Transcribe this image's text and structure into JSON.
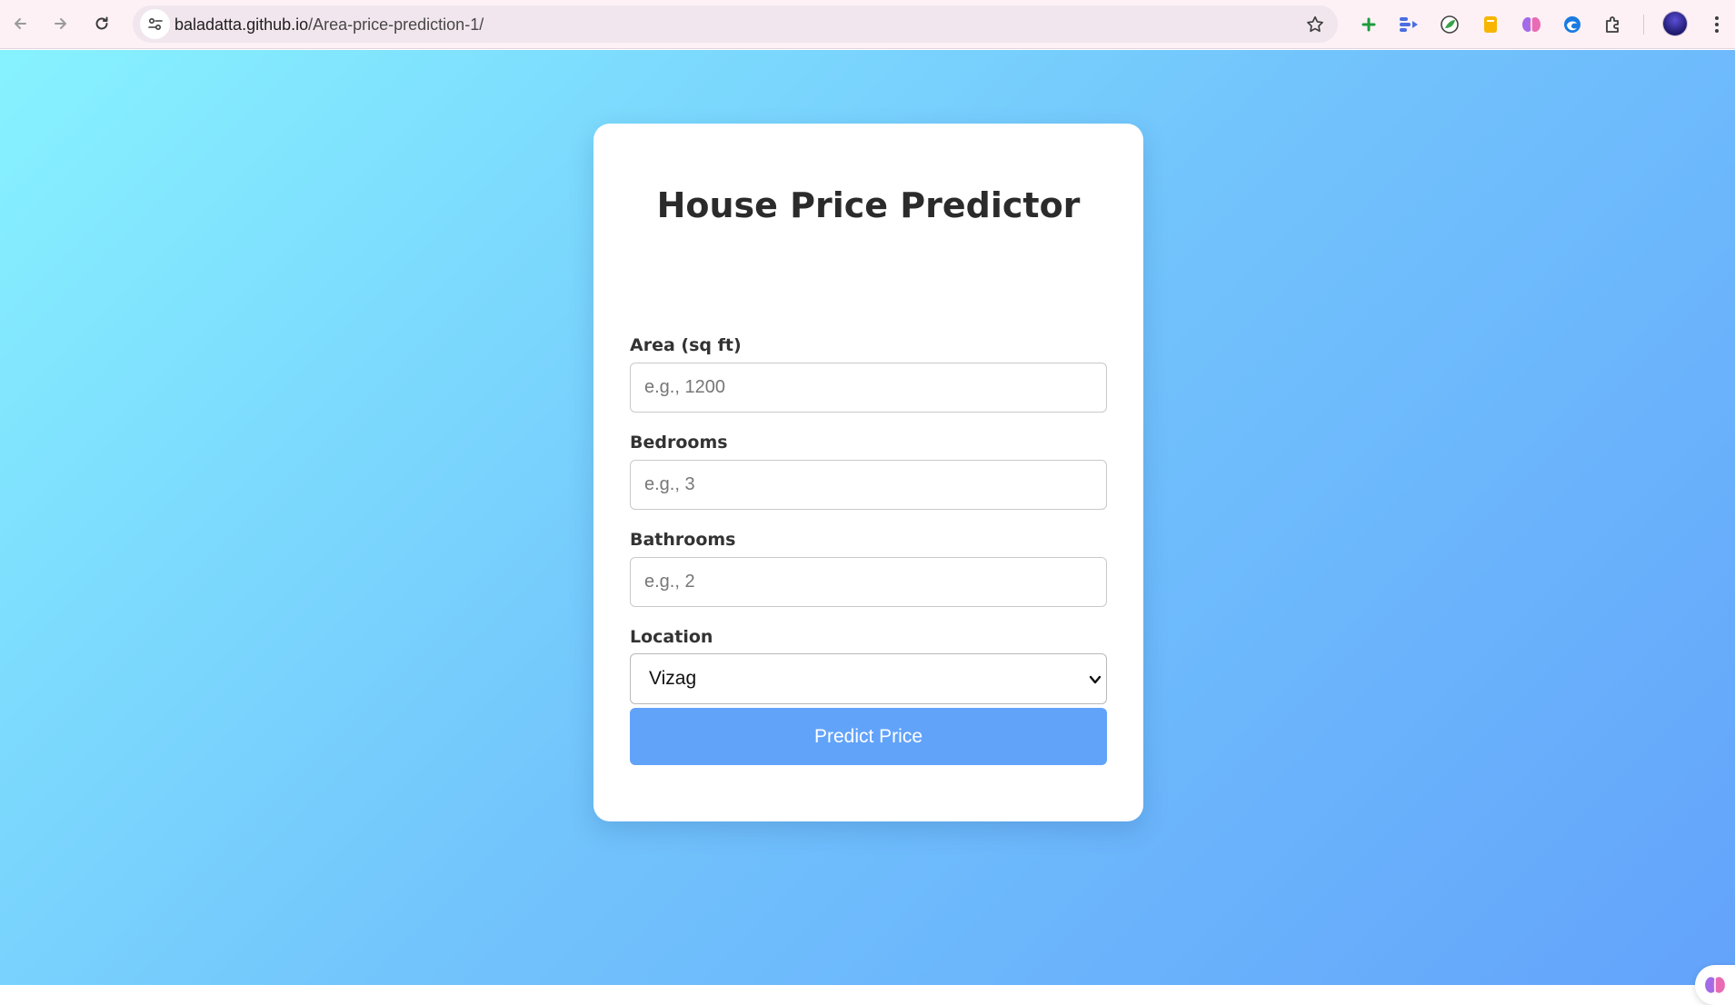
{
  "browser": {
    "url_host": "baladatta.github.io",
    "url_path": "/Area-price-prediction-1/",
    "icons": [
      "back-icon",
      "forward-icon",
      "reload-icon",
      "site-info-icon",
      "bookmark-star-icon",
      "add-extension-icon",
      "bars-extension-icon",
      "leaf-extension-icon",
      "note-extension-icon",
      "brain-extension-icon",
      "edge-extension-icon",
      "puzzle-extensions-icon",
      "profile-avatar",
      "more-menu-icon"
    ]
  },
  "form": {
    "title": "House Price Predictor",
    "area": {
      "label": "Area (sq ft)",
      "placeholder": "e.g., 1200",
      "value": ""
    },
    "bedrooms": {
      "label": "Bedrooms",
      "placeholder": "e.g., 3",
      "value": ""
    },
    "bathrooms": {
      "label": "Bathrooms",
      "placeholder": "e.g., 2",
      "value": ""
    },
    "location": {
      "label": "Location",
      "selected": "Vizag"
    },
    "submit_label": "Predict Price"
  },
  "colors": {
    "gradient_start": "#87f2ff",
    "gradient_end": "#63a3fb",
    "button": "#62a3fa",
    "title_text": "#2b2b2b"
  }
}
